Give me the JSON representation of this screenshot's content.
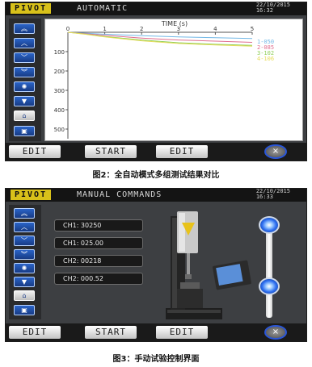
{
  "colors": {
    "series_1_050": "#73b8e6",
    "series_2_085": "#e06e8f",
    "series_3_102": "#8fcf58",
    "series_4_106": "#e6dc5a",
    "logo_bg": "#d8c11a",
    "nav_blue": "#2b64c8"
  },
  "screen1": {
    "logo": "PIVOT",
    "title": "AUTOMATIC",
    "date": "22/10/2015",
    "time": "16:32",
    "nav_icons": [
      "double-up-icon",
      "up-icon",
      "down-icon",
      "double-down-icon",
      "burst-icon",
      "probe-down-icon",
      "home-icon",
      "menu-icon"
    ],
    "buttons": {
      "edit1": "EDIT",
      "start": "START",
      "edit2": "EDIT",
      "close": "×"
    }
  },
  "screen2": {
    "logo": "PIVOT",
    "title": "MANUAL COMMANDS",
    "date": "22/10/2015",
    "time": "16:33",
    "nav_icons": [
      "double-up-icon",
      "up-icon",
      "down-icon",
      "double-down-icon",
      "burst-icon",
      "probe-down-icon",
      "home-icon",
      "menu-icon"
    ],
    "channels": [
      "CH1: 30250",
      "CH1: 025.00",
      "CH2: 00218",
      "CH2: 000.52"
    ],
    "buttons": {
      "edit1": "EDIT",
      "start": "START",
      "edit2": "EDIT",
      "close": "×"
    }
  },
  "captions": {
    "fig2": "图2：全自动模式多组测试结果对比",
    "fig3": "图3：手动试验控制界面"
  },
  "chart_data": {
    "type": "line",
    "xlabel": "TIME (s)",
    "ylabel": "",
    "x_ticks": [
      "0",
      "1",
      "2",
      "3",
      "4",
      "5"
    ],
    "y_ticks": [
      "100",
      "200",
      "300",
      "400",
      "500"
    ],
    "xlim": [
      0,
      5
    ],
    "ylim": [
      0,
      550
    ],
    "y_inverted": true,
    "legend_position": "right",
    "series": [
      {
        "name": "1-050",
        "x": [
          0,
          0.5,
          1,
          2,
          3,
          4,
          5
        ],
        "y": [
          0,
          5,
          10,
          18,
          24,
          28,
          32
        ]
      },
      {
        "name": "2-085",
        "x": [
          0,
          0.5,
          1,
          2,
          3,
          4,
          5
        ],
        "y": [
          0,
          8,
          16,
          30,
          40,
          46,
          52
        ]
      },
      {
        "name": "3-102",
        "x": [
          0,
          0.5,
          1,
          2,
          3,
          4,
          5
        ],
        "y": [
          0,
          10,
          22,
          40,
          54,
          62,
          68
        ]
      },
      {
        "name": "4-106",
        "x": [
          0,
          0.5,
          1,
          2,
          3,
          4,
          5
        ],
        "y": [
          0,
          11,
          24,
          44,
          58,
          66,
          72
        ]
      }
    ]
  }
}
